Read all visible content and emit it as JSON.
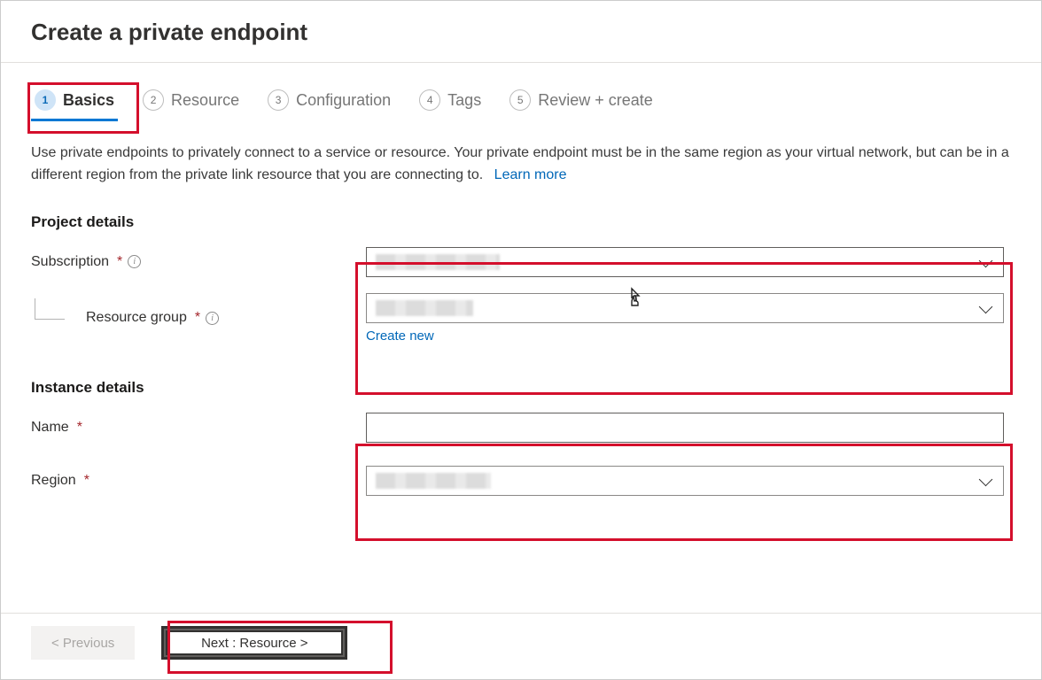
{
  "header": {
    "title": "Create a private endpoint"
  },
  "tabs": [
    {
      "num": "1",
      "label": "Basics"
    },
    {
      "num": "2",
      "label": "Resource"
    },
    {
      "num": "3",
      "label": "Configuration"
    },
    {
      "num": "4",
      "label": "Tags"
    },
    {
      "num": "5",
      "label": "Review + create"
    }
  ],
  "description": "Use private endpoints to privately connect to a service or resource. Your private endpoint must be in the same region as your virtual network, but can be in a different region from the private link resource that you are connecting to.",
  "learn_more": "Learn more",
  "section1": {
    "title": "Project details",
    "subscription_label": "Subscription",
    "resource_group_label": "Resource group",
    "create_new": "Create new"
  },
  "section2": {
    "title": "Instance details",
    "name_label": "Name",
    "region_label": "Region"
  },
  "footer": {
    "previous": "< Previous",
    "next": "Next : Resource >"
  }
}
